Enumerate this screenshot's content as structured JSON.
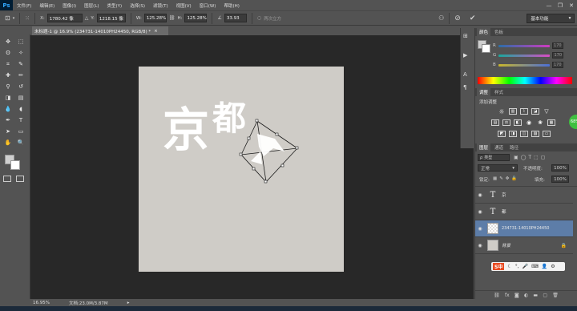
{
  "app": {
    "logo": "Ps"
  },
  "menu": [
    "文件(F)",
    "编辑(E)",
    "图像(I)",
    "图层(L)",
    "类型(Y)",
    "选择(S)",
    "滤镜(T)",
    "视图(V)",
    "窗口(W)",
    "帮助(H)"
  ],
  "options": {
    "x_label": "X:",
    "x_value": "1780.42 像",
    "y_label": "Y:",
    "y_value": "1218.15 像",
    "w_label": "W:",
    "w_value": "125.28%",
    "h_label": "H:",
    "h_value": "125.28%",
    "angle_value": "33.93",
    "angle_unit": "度",
    "h2_label": "H:",
    "h2_value": "0.00",
    "v_label": "V:",
    "v_value": "0.00",
    "interp": "两次立方",
    "workspace": "基本功能"
  },
  "document": {
    "tab_title": "未标题-1 @ 16.9% (234731-14010PH24450, RGB/8) *",
    "close": "×",
    "canvas_text_1": "京",
    "canvas_text_2": "都"
  },
  "status": {
    "zoom": "16.95%",
    "doc_info": "文档:23.0M/3.87M"
  },
  "panels": {
    "color_tabs": [
      "颜色",
      "色板"
    ],
    "color_r": "R",
    "color_g": "G",
    "color_b": "B",
    "color_r_val": "170",
    "color_g_val": "170",
    "color_b_val": "170",
    "adjust_tabs": [
      "调整",
      "样式"
    ],
    "adjust_title": "添加调整",
    "layers_tabs": [
      "图层",
      "通道",
      "路径"
    ],
    "kind_label": "类型",
    "blend_mode": "正常",
    "opacity_label": "不透明度:",
    "opacity_value": "100%",
    "lock_label": "锁定:",
    "fill_label": "填充:",
    "fill_value": "100%",
    "layers": [
      {
        "name": "京",
        "type": "text"
      },
      {
        "name": "都",
        "type": "text"
      },
      {
        "name": "234731-14010PH24450",
        "type": "smart"
      },
      {
        "name": "背景",
        "type": "background"
      }
    ]
  },
  "badge": {
    "value": "68%"
  },
  "ime": {
    "label": "S中"
  },
  "colors": {
    "accent": "#5d7da8",
    "canvas": "#cfccc7",
    "dark": "#282828"
  }
}
